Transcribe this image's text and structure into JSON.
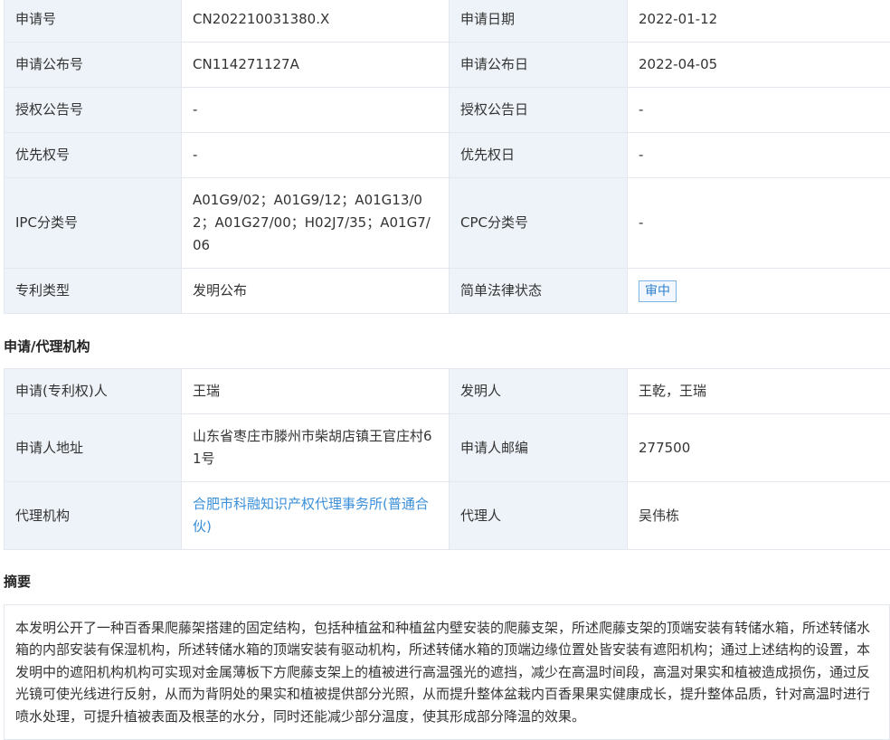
{
  "basic": {
    "rows": [
      {
        "k1": "申请号",
        "v1": "CN202210031380.X",
        "k2": "申请日期",
        "v2": "2022-01-12"
      },
      {
        "k1": "申请公布号",
        "v1": "CN114271127A",
        "k2": "申请公布日",
        "v2": "2022-04-05"
      },
      {
        "k1": "授权公告号",
        "v1": "-",
        "k2": "授权公告日",
        "v2": "-"
      },
      {
        "k1": "优先权号",
        "v1": "-",
        "k2": "优先权日",
        "v2": "-"
      },
      {
        "k1": "IPC分类号",
        "v1": "A01G9/02；A01G9/12；A01G13/02；A01G27/00；H02J7/35；A01G7/06",
        "k2": "CPC分类号",
        "v2": "-"
      },
      {
        "k1": "专利类型",
        "v1": "发明公布",
        "k2": "简单法律状态",
        "v2": "审中"
      }
    ]
  },
  "agency_section_title": "申请/代理机构",
  "agency": {
    "rows": [
      {
        "k1": "申请(专利权)人",
        "v1": "王瑞",
        "k2": "发明人",
        "v2": "王乾，王瑞"
      },
      {
        "k1": "申请人地址",
        "v1": "山东省枣庄市滕州市柴胡店镇王官庄村61号",
        "k2": "申请人邮编",
        "v2": "277500"
      },
      {
        "k1": "代理机构",
        "v1": "合肥市科融知识产权代理事务所(普通合伙)",
        "k2": "代理人",
        "v2": "吴伟栋"
      }
    ]
  },
  "abstract_section_title": "摘要",
  "abstract_text": "本发明公开了一种百香果爬藤架搭建的固定结构，包括种植盆和种植盆内壁安装的爬藤支架，所述爬藤支架的顶端安装有转储水箱，所述转储水箱的内部安装有保湿机构，所述转储水箱的顶端安装有驱动机构，所述转储水箱的顶端边缘位置处皆安装有遮阳机构；通过上述结构的设置，本发明中的遮阳机构机构可实现对金属薄板下方爬藤支架上的植被进行高温强光的遮挡，减少在高温时间段，高温对果实和植被造成损伤，通过反光镜可使光线进行反射，从而为背阴处的果实和植被提供部分光照，从而提升整体盆栽内百香果果实健康成长，提升整体品质，针对高温时进行喷水处理，可提升植被表面及根茎的水分，同时还能减少部分温度，使其形成部分降温的效果。",
  "colors": {
    "key_bg": "#eef3f9",
    "border": "#e3e8ee",
    "link": "#3a8fd9",
    "badge": "#2f7fcf"
  }
}
